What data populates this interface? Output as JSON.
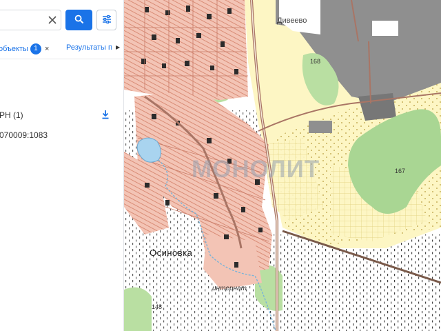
{
  "search": {
    "value": "",
    "placeholder": ""
  },
  "tabs": {
    "objects_label": "объекты",
    "objects_count": "1",
    "objects_close": "×",
    "results_label": "Результаты пс"
  },
  "results": {
    "group_title": "РН (1)",
    "items": [
      {
        "cadastral_number": "070009:1083"
      }
    ]
  },
  "map": {
    "labels": {
      "village_top": "Дивеево",
      "height_168": "168",
      "height_167": "167",
      "height_148": "148",
      "village_bottom": "Осиновка",
      "internat": "интернат",
      "watermark": "МОНОЛИТ"
    }
  },
  "colors": {
    "accent": "#1a73e8",
    "built_up": "#f3c4b5",
    "built_up_stroke": "#d98c76",
    "buildings": "#2a2a2a",
    "fields": "#fdf6c4",
    "forest": "#b9dfa2",
    "industrial": "#8a8a8a",
    "road": "#a07060"
  },
  "icons": {
    "clear": "close-icon",
    "search": "search-icon",
    "filter": "filter-icon",
    "download": "download-icon",
    "tab_scroll": "chevron-right-icon"
  }
}
